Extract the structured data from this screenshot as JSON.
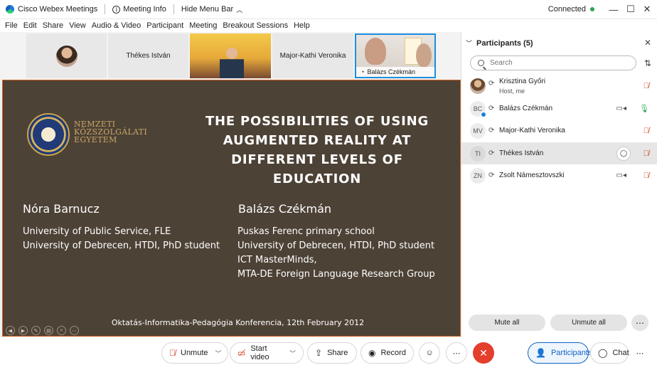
{
  "titlebar": {
    "app_name": "Cisco Webex Meetings",
    "meeting_info": "Meeting Info",
    "hide_menu": "Hide Menu Bar",
    "status": "Connected",
    "minimize": "—",
    "maximize": "☐",
    "close": "✕"
  },
  "menu": [
    "File",
    "Edit",
    "Share",
    "View",
    "Audio & Video",
    "Participant",
    "Meeting",
    "Breakout Sessions",
    "Help"
  ],
  "thumbnails": {
    "name1": "Thékes István",
    "name2": "Major-Kathi Veronika",
    "active_name": "Balázs Czékmán"
  },
  "slide": {
    "logo_line1": "NEMZETI",
    "logo_line2": "KÖZSZOLGÁLATI",
    "logo_line3": "EGYETEM",
    "title_line1": "THE POSSIBILITIES OF USING",
    "title_line2": "AUGMENTED REALITY AT",
    "title_line3": "DIFFERENT LEVELS OF EDUCATION",
    "author1": "Nóra Barnucz",
    "author1_aff1": "University of Public Service, FLE",
    "author1_aff2": "University of Debrecen, HTDI, PhD student",
    "author2": "Balázs Czékmán",
    "author2_aff1": "Puskas Ferenc primary school",
    "author2_aff2": "University of Debrecen, HTDI, PhD student",
    "author2_aff3": "ICT MasterMinds,",
    "author2_aff4": "MTA-DE  Foreign Language Research Group",
    "footer": "Oktatás-Informatika-Pedagógia Konferencia, 12th February 2012"
  },
  "participants": {
    "header": "Participants (5)",
    "search_placeholder": "Search",
    "list": [
      {
        "initials": "",
        "name": "Krisztina Győri",
        "role": "Host, me"
      },
      {
        "initials": "BC",
        "name": "Balázs Czékmán",
        "role": ""
      },
      {
        "initials": "MV",
        "name": "Major-Kathi Veronika",
        "role": ""
      },
      {
        "initials": "TI",
        "name": "Thékes István",
        "role": ""
      },
      {
        "initials": "ZN",
        "name": "Zsolt Námesztovszki",
        "role": ""
      }
    ],
    "mute_all": "Mute all",
    "unmute_all": "Unmute all"
  },
  "toolbar": {
    "unmute": "Unmute",
    "start_video": "Start video",
    "share": "Share",
    "record": "Record",
    "participants": "Participants",
    "chat": "Chat"
  },
  "colors": {
    "slide_bg": "#4d4236",
    "accent": "#1264c4",
    "end_red": "#e43e2d",
    "connected_green": "#2ca44e"
  }
}
